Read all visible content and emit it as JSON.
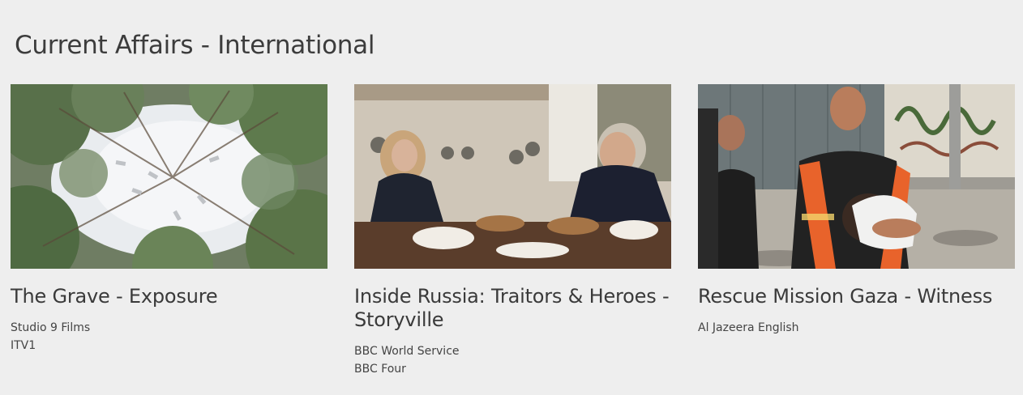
{
  "section": {
    "title": "Current Affairs - International"
  },
  "cards": [
    {
      "title": "The Grave - Exposure",
      "meta": [
        "Studio 9 Films",
        "ITV1"
      ],
      "image": "aerial-snowy-forest-image"
    },
    {
      "title": "Inside Russia: Traitors & Heroes - Storyville",
      "meta": [
        "BBC World Service",
        "BBC Four"
      ],
      "image": "kitchen-dinner-conversation-image"
    },
    {
      "title": "Rescue Mission Gaza - Witness",
      "meta": [
        "Al Jazeera English"
      ],
      "image": "rescuer-carrying-child-image"
    }
  ],
  "colors": {
    "background": "#eeeeee",
    "text": "#3a3a3a",
    "vest_orange": "#e8632b"
  }
}
